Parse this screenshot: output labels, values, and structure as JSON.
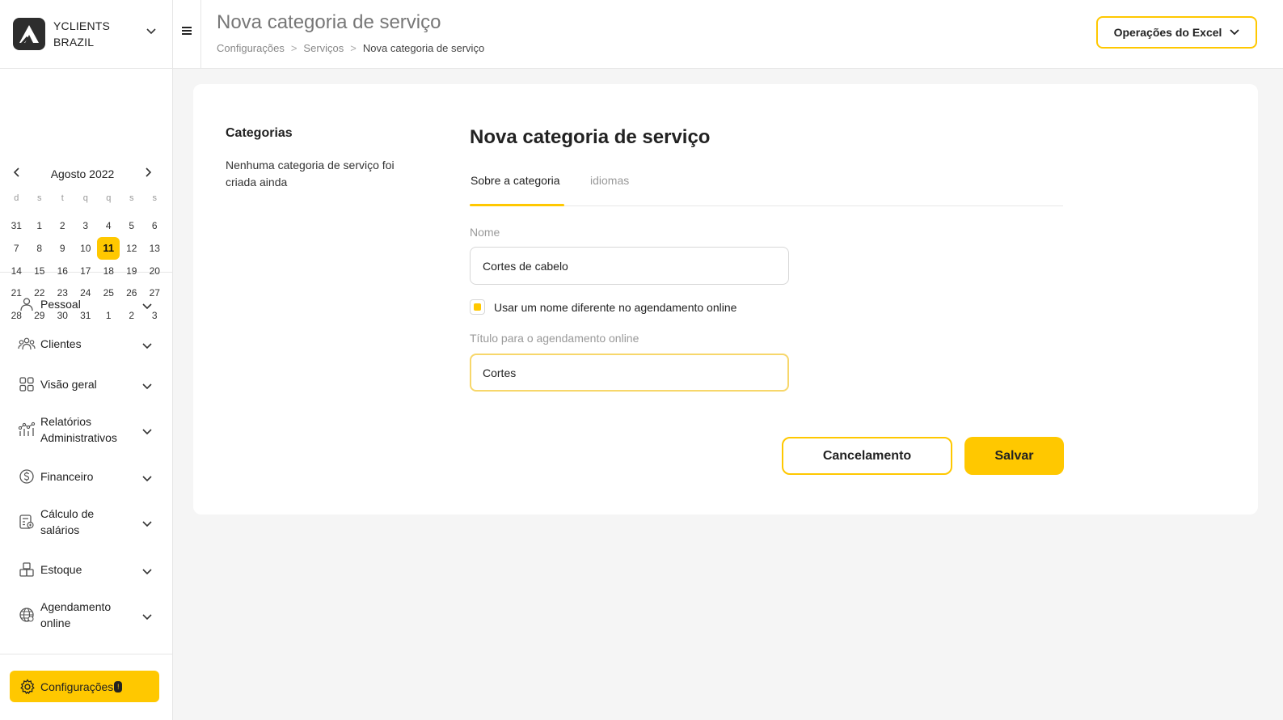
{
  "brand": {
    "line1": "YCLIENTS",
    "line2": "BRAZIL"
  },
  "header": {
    "title": "Nova categoria de serviço",
    "breadcrumb": [
      "Configurações",
      "Serviços",
      "Nova categoria de serviço"
    ],
    "breadcrumb_sep": ">",
    "excel_button": "Operações do Excel"
  },
  "calendar": {
    "title": "Agosto 2022",
    "weekdays": [
      "d",
      "s",
      "t",
      "q",
      "q",
      "s",
      "s"
    ],
    "weeks": [
      [
        "31",
        "1",
        "2",
        "3",
        "4",
        "5",
        "6"
      ],
      [
        "7",
        "8",
        "9",
        "10",
        "11",
        "12",
        "13"
      ],
      [
        "14",
        "15",
        "16",
        "17",
        "18",
        "19",
        "20"
      ],
      [
        "21",
        "22",
        "23",
        "24",
        "25",
        "26",
        "27"
      ],
      [
        "28",
        "29",
        "30",
        "31",
        "1",
        "2",
        "3"
      ]
    ],
    "today": "11"
  },
  "nav": [
    {
      "icon": "person-icon",
      "label": "Pessoal"
    },
    {
      "icon": "clients-icon",
      "label": "Clientes"
    },
    {
      "icon": "overview-grid-icon",
      "label": "Visão geral"
    },
    {
      "icon": "reports-icon",
      "label": "Relatórios Administrativos"
    },
    {
      "icon": "dollar-icon",
      "label": "Financeiro"
    },
    {
      "icon": "calculator-icon",
      "label": "Cálculo de salários"
    },
    {
      "icon": "boxes-icon",
      "label": "Estoque"
    },
    {
      "icon": "globe-icon",
      "label": "Agendamento online"
    }
  ],
  "settings": {
    "label": "Configurações",
    "badge": "!"
  },
  "categories": {
    "title": "Categorias",
    "empty": "Nenhuma categoria de serviço foi criada ainda"
  },
  "form": {
    "title": "Nova categoria de serviço",
    "tabs": [
      "Sobre a categoria",
      "idiomas"
    ],
    "name_label": "Nome",
    "name_value": "Cortes de cabelo",
    "checkbox_label": "Usar um nome diferente no agendamento online",
    "checkbox_checked": true,
    "online_title_label": "Título para o agendamento online",
    "online_title_value": "Cortes",
    "cancel_label": "Cancelamento",
    "save_label": "Salvar"
  },
  "colors": {
    "accent": "#ffc800",
    "background": "#f5f5f5"
  }
}
